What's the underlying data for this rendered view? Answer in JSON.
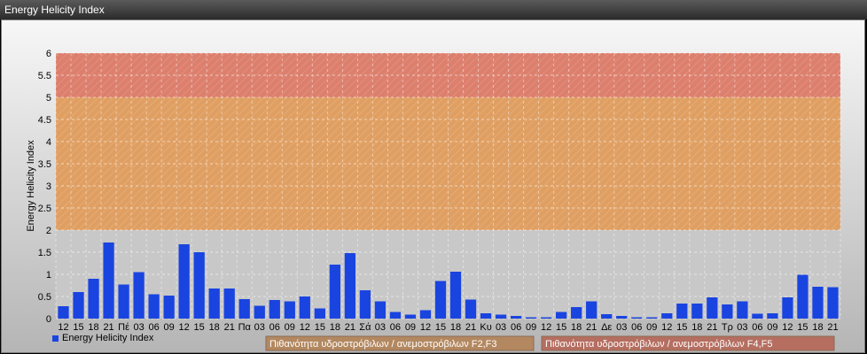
{
  "window": {
    "title": "Energy Helicity Index"
  },
  "chart_data": {
    "type": "bar",
    "ylabel": "Energy Helicity Index",
    "ylim": [
      0,
      6
    ],
    "yticks": [
      "0",
      "0.5",
      "1",
      "1.5",
      "2",
      "2.5",
      "3",
      "3.5",
      "4",
      "4.5",
      "5",
      "5.5",
      "6"
    ],
    "grid": true,
    "categories": [
      "12",
      "15",
      "18",
      "21",
      "Πέ",
      "03",
      "06",
      "09",
      "12",
      "15",
      "18",
      "21",
      "Πα",
      "03",
      "06",
      "09",
      "12",
      "15",
      "18",
      "21",
      "Σά",
      "03",
      "06",
      "09",
      "12",
      "15",
      "18",
      "21",
      "Κυ",
      "03",
      "06",
      "09",
      "12",
      "15",
      "18",
      "21",
      "Δε",
      "03",
      "06",
      "09",
      "12",
      "15",
      "18",
      "21",
      "Τρ",
      "03",
      "06",
      "09",
      "12",
      "15",
      "18",
      "21"
    ],
    "series": [
      {
        "name": "Energy Helicity Index",
        "color": "#1a44e0",
        "values": [
          0.28,
          0.6,
          0.9,
          1.72,
          0.77,
          1.05,
          0.55,
          0.52,
          1.68,
          1.5,
          0.68,
          0.68,
          0.44,
          0.29,
          0.42,
          0.39,
          0.5,
          0.23,
          1.22,
          1.48,
          0.64,
          0.39,
          0.15,
          0.09,
          0.19,
          0.85,
          1.06,
          0.43,
          0.12,
          0.09,
          0.06,
          0.03,
          0.03,
          0.15,
          0.26,
          0.39,
          0.1,
          0.06,
          0.03,
          0.03,
          0.12,
          0.34,
          0.34,
          0.48,
          0.32,
          0.39,
          0.11,
          0.12,
          0.48,
          0.99,
          0.72,
          0.71
        ]
      }
    ],
    "bands": [
      {
        "from": 2,
        "to": 5,
        "color": "#e29a56",
        "label": "Πιθανότητα υδροστρόβιλων / ανεμοστρόβιλων F2,F3"
      },
      {
        "from": 5,
        "to": 6,
        "color": "#df7763",
        "label": "Πιθανότητα υδροστρόβιλων / ανεμοστρόβιλων F4,F5"
      }
    ],
    "legend_position": "bottom-left"
  }
}
